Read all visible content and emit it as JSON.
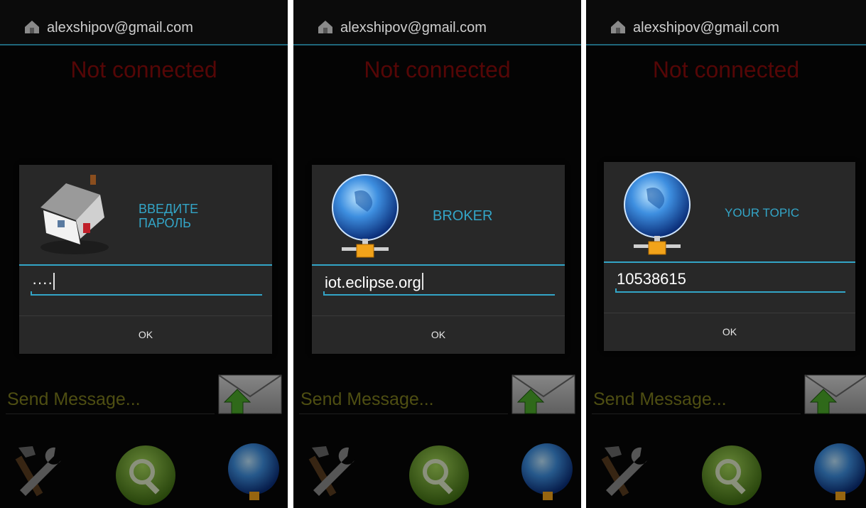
{
  "screens": [
    {
      "header": {
        "account": "alexshipov@gmail.com"
      },
      "status": "Not connected",
      "message_placeholder": "Send Message...",
      "dialog": {
        "title_line1": "ВВЕДИТЕ",
        "title_line2": "ПАРОЛЬ",
        "value": "····",
        "ok_label": "OK",
        "icon": "house-icon"
      }
    },
    {
      "header": {
        "account": "alexshipov@gmail.com"
      },
      "status": "Not connected",
      "message_placeholder": "Send Message...",
      "dialog": {
        "title_line1": "BROKER",
        "title_line2": "",
        "value": "iot.eclipse.org",
        "ok_label": "OK",
        "icon": "network-globe-icon"
      }
    },
    {
      "header": {
        "account": "alexshipov@gmail.com"
      },
      "status": "Not connected",
      "message_placeholder": "Send Message...",
      "dialog": {
        "title_line1": "YOUR TOPIC",
        "title_line2": "",
        "value": "10538615",
        "ok_label": "OK",
        "icon": "network-globe-icon"
      }
    }
  ],
  "colors": {
    "accent": "#33a5c7",
    "status": "#8a0b0b",
    "placeholder": "#7f7f1e",
    "dialog": "#282828"
  }
}
